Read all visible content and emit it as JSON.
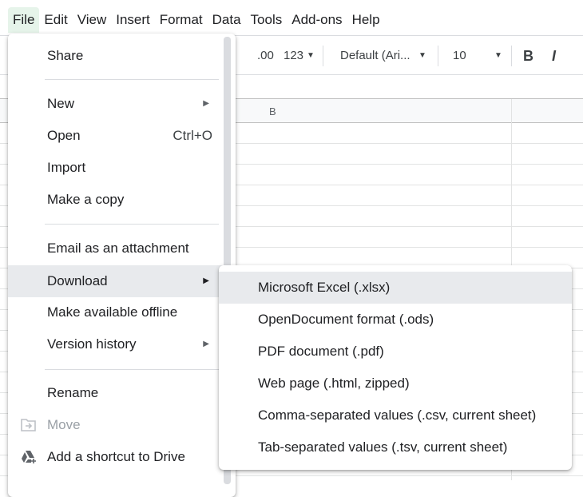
{
  "menubar": [
    "File",
    "Edit",
    "View",
    "Insert",
    "Format",
    "Data",
    "Tools",
    "Add-ons",
    "Help"
  ],
  "toolbar": {
    "dec_decrease": ".0",
    "dec_increase": ".00",
    "format": "123",
    "font": "Default (Ari...",
    "size": "10",
    "bold": "B",
    "italic": "I"
  },
  "column_header": "B",
  "file_menu": {
    "share": "Share",
    "new": "New",
    "open": "Open",
    "open_shortcut": "Ctrl+O",
    "import": "Import",
    "copy": "Make a copy",
    "email": "Email as an attachment",
    "download": "Download",
    "offline": "Make available offline",
    "version": "Version history",
    "rename": "Rename",
    "move": "Move",
    "shortcut": "Add a shortcut to Drive"
  },
  "download_menu": [
    "Microsoft Excel (.xlsx)",
    "OpenDocument format (.ods)",
    "PDF document (.pdf)",
    "Web page (.html, zipped)",
    "Comma-separated values (.csv, current sheet)",
    "Tab-separated values (.tsv, current sheet)"
  ]
}
